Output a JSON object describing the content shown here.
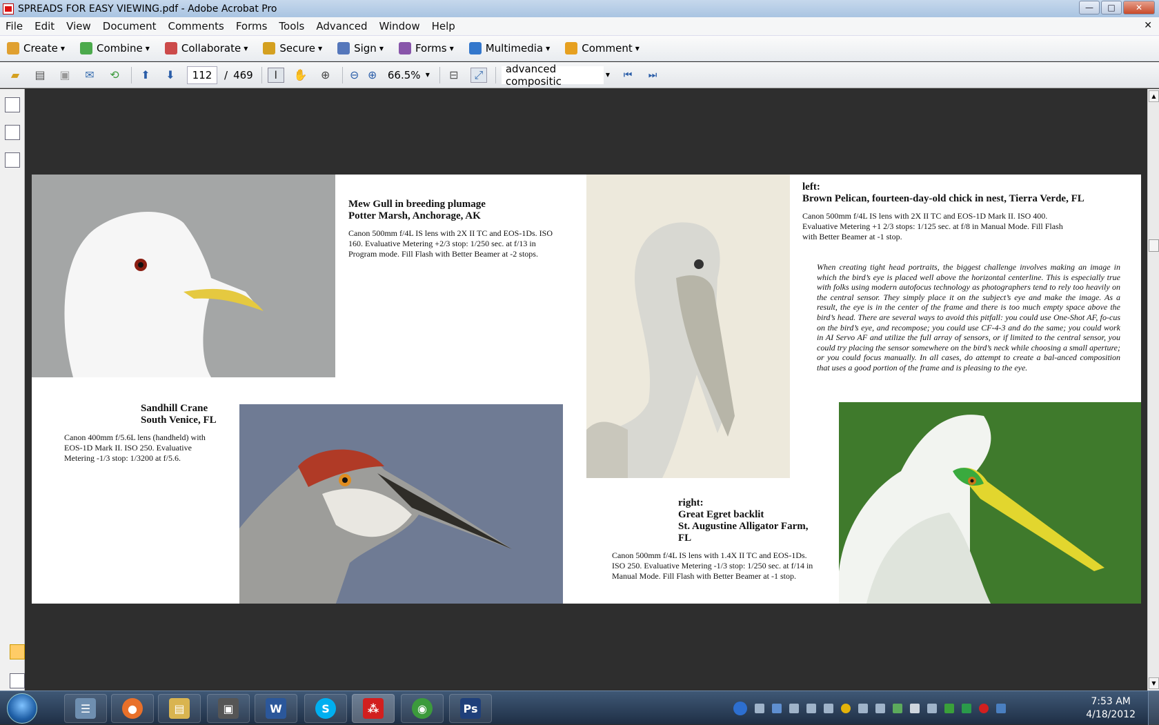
{
  "window": {
    "title": "SPREADS FOR EASY VIEWING.pdf - Adobe Acrobat Pro",
    "minimize": "—",
    "maximize": "□",
    "close": "✕"
  },
  "menu": [
    "File",
    "Edit",
    "View",
    "Document",
    "Comments",
    "Forms",
    "Tools",
    "Advanced",
    "Window",
    "Help"
  ],
  "menu_close": "✕",
  "toolbar1": [
    {
      "label": "Create",
      "icon": "create-icon",
      "color": "#e0a030"
    },
    {
      "label": "Combine",
      "icon": "combine-icon",
      "color": "#4caa4c"
    },
    {
      "label": "Collaborate",
      "icon": "collaborate-icon",
      "color": "#cc4a4a"
    },
    {
      "label": "Secure",
      "icon": "lock-icon",
      "color": "#d4a020"
    },
    {
      "label": "Sign",
      "icon": "pen-icon",
      "color": "#5577bb"
    },
    {
      "label": "Forms",
      "icon": "forms-icon",
      "color": "#8855aa"
    },
    {
      "label": "Multimedia",
      "icon": "multimedia-icon",
      "color": "#3377cc"
    },
    {
      "label": "Comment",
      "icon": "comment-icon",
      "color": "#e6a020"
    }
  ],
  "toolbar2": {
    "current_page": "112",
    "page_sep": "/",
    "total_pages": "469",
    "zoom": "66.5%",
    "search_value": "advanced compositic"
  },
  "page": {
    "gull": {
      "title_line1": "Mew Gull in breeding plumage",
      "title_line2": "Potter Marsh, Anchorage, AK",
      "body": "Canon 500mm f/4L IS lens with 2X II TC and EOS-1Ds. ISO 160. Evaluative Metering +2/3 stop: 1/250 sec. at f/13 in Program mode. Fill Flash with Better Beamer at -2 stops."
    },
    "pelican": {
      "prefix": "left:",
      "title": "Brown Pelican, fourteen-day-old chick in nest, Tierra Verde, FL",
      "body": "Canon 500mm f/4L IS lens with 2X II TC and EOS-1D Mark II.  ISO 400. Evaluative Metering +1 2/3 stops: 1/125 sec. at f/8 in Manual Mode. Fill Flash with Better Beamer at -1 stop."
    },
    "essay": "When creating tight head portraits, the biggest challenge involves making an image in which the bird’s eye is placed well above the horizontal centerline. This is especially true with folks using modern autofocus technology as photographers tend to rely too heavily on the central sensor. They simply place it on the subject’s eye and make the image. As a result, the eye is in the center of the frame and there is too much empty space above the bird’s head. There are several ways to avoid this pitfall: you could use One-Shot AF, fo-cus on the bird’s eye, and recompose; you could use CF-4-3 and do the same; you could work in AI Servo AF and utilize the full array of sensors, or if limited to the central sensor, you could try placing the sensor somewhere on the bird’s neck while choosing a small aperture; or you could focus manually. In all cases, do attempt to create a bal-anced composition that uses a good portion of the frame and is pleasing to the eye.",
    "crane": {
      "title_line1": "Sandhill Crane",
      "title_line2": "South Venice, FL",
      "body": "Canon 400mm f/5.6L lens (handheld) with EOS-1D Mark II.  ISO 250. Evaluative Metering -1/3 stop: 1/3200 at f/5.6."
    },
    "egret": {
      "prefix": "right:",
      "title_line1": "Great Egret backlit",
      "title_line2": "St. Augustine Alligator Farm, FL",
      "body": "Canon 500mm f/4L IS lens with 1.4X II TC and EOS-1Ds. ISO 250. Evaluative Metering -1/3 stop: 1/250 sec. at f/14 in Manual Mode. Fill Flash with Better Beamer at -1 stop."
    }
  },
  "taskbar": {
    "apps": [
      {
        "name": "calculator-app",
        "color": "#6f8fb0",
        "glyph": "☰"
      },
      {
        "name": "firefox-app",
        "color": "#e8702a",
        "glyph": "●"
      },
      {
        "name": "explorer-app",
        "color": "#d9b450",
        "glyph": "▤"
      },
      {
        "name": "camera-app",
        "color": "#555555",
        "glyph": "▣"
      },
      {
        "name": "word-app",
        "color": "#2b579a",
        "glyph": "W"
      },
      {
        "name": "skype-app",
        "color": "#00aff0",
        "glyph": "S"
      },
      {
        "name": "acrobat-app",
        "color": "#d21f1f",
        "glyph": "⁂"
      },
      {
        "name": "chrome-app",
        "color": "#3c9a3c",
        "glyph": "◉"
      },
      {
        "name": "photoshop-app",
        "color": "#1f3f7a",
        "glyph": "Ps"
      }
    ],
    "time": "7:53 AM",
    "date": "4/18/2012"
  }
}
